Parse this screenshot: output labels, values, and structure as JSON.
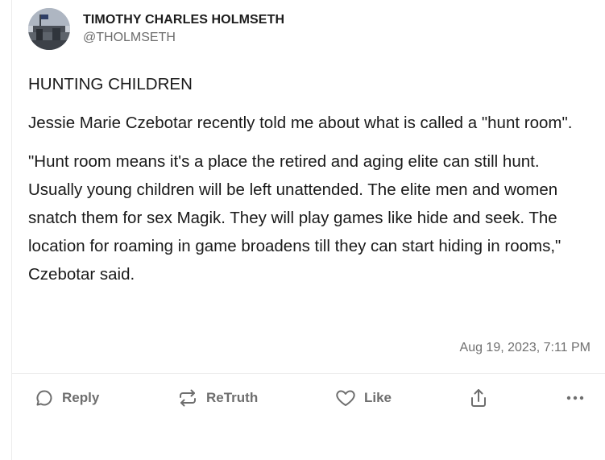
{
  "post": {
    "display_name": "TIMOTHY CHARLES HOLMSETH",
    "handle": "@THOLMSETH",
    "paragraphs": [
      "HUNTING CHILDREN",
      "Jessie Marie Czebotar recently told me about what is called a \"hunt room\".",
      "\"Hunt room means it's a place the retired and aging elite can still hunt. Usually young children will be left unattended. The elite men and women snatch them for sex Magik.  They will play games like hide and seek. The location for roaming in game broadens till they can start hiding in rooms,\" Czebotar said."
    ],
    "timestamp": "Aug 19, 2023, 7:11 PM"
  },
  "actions": {
    "reply_label": "Reply",
    "retruth_label": "ReTruth",
    "like_label": "Like"
  },
  "icons": {
    "reply": "speech-bubble-icon",
    "retruth": "repost-arrows-icon",
    "like": "heart-icon",
    "share": "share-icon",
    "more": "ellipsis-icon"
  },
  "colors": {
    "text": "#1a1a1a",
    "muted": "#6e6e6e",
    "divider": "#ececec"
  }
}
